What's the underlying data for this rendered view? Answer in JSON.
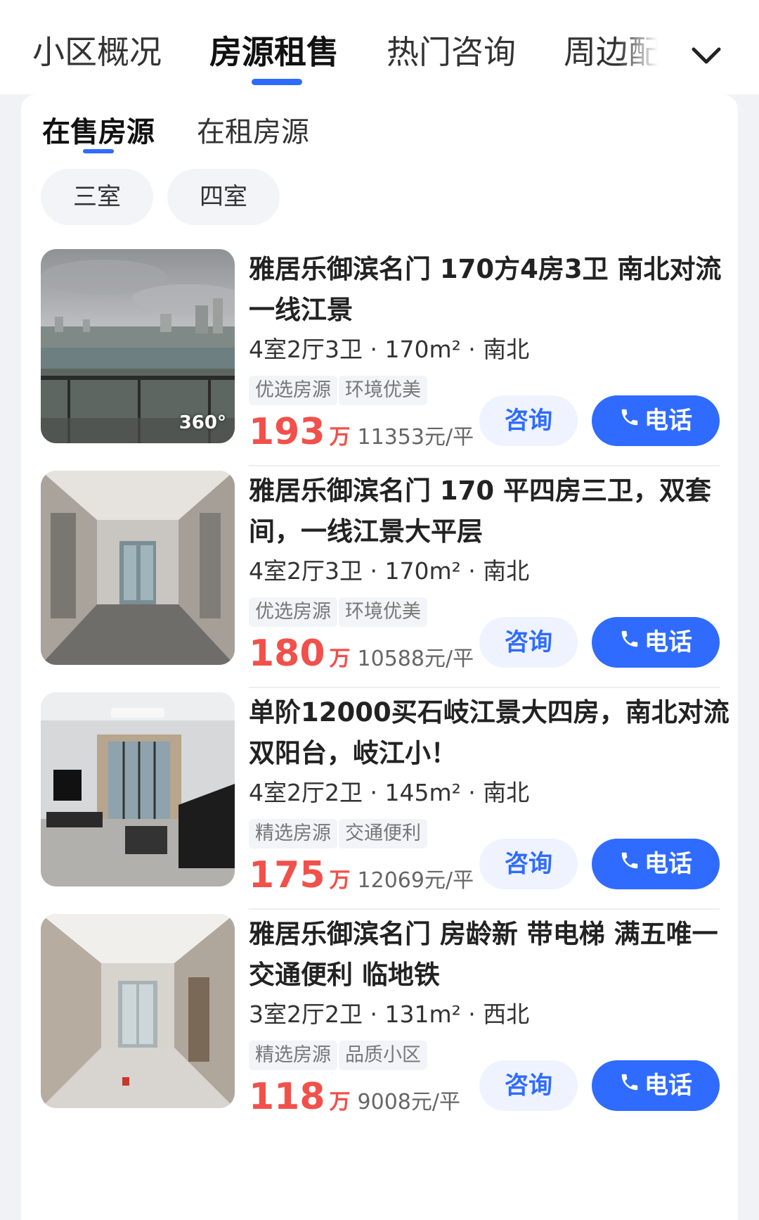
{
  "top_tabs": [
    {
      "label": "小区概况",
      "active": false
    },
    {
      "label": "房源租售",
      "active": true
    },
    {
      "label": "热门咨询",
      "active": false
    },
    {
      "label": "周边配",
      "active": false
    }
  ],
  "sub_tabs": [
    {
      "label": "在售房源",
      "active": true
    },
    {
      "label": "在租房源",
      "active": false
    }
  ],
  "filter_chips": [
    "三室",
    "四室"
  ],
  "consult_label": "咨询",
  "call_label": "电话",
  "listings": [
    {
      "title": "雅居乐御滨名门 170方4房3卫 南北对流 一线江景",
      "specs": "4室2厅3卫 · 170m² · 南北",
      "tags": [
        "优选房源",
        "环境优美"
      ],
      "price": "193",
      "price_unit": "万",
      "unit_price": "11353元/平",
      "badge": "360°"
    },
    {
      "title": "雅居乐御滨名门 170 平四房三卫，双套间，一线江景大平层",
      "specs": "4室2厅3卫 · 170m² · 南北",
      "tags": [
        "优选房源",
        "环境优美"
      ],
      "price": "180",
      "price_unit": "万",
      "unit_price": "10588元/平"
    },
    {
      "title": "单阶12000买石岐江景大四房，南北对流双阳台，岐江小！",
      "specs": "4室2厅2卫 · 145m² · 南北",
      "tags": [
        "精选房源",
        "交通便利"
      ],
      "price": "175",
      "price_unit": "万",
      "unit_price": "12069元/平"
    },
    {
      "title": "雅居乐御滨名门 房龄新 带电梯 满五唯一 交通便利 临地铁",
      "specs": "3室2厅2卫 · 131m² · 西北",
      "tags": [
        "精选房源",
        "品质小区"
      ],
      "price": "118",
      "price_unit": "万",
      "unit_price": "9008元/平"
    }
  ],
  "colors": {
    "accent": "#2f6bff",
    "price": "#f2504b",
    "tag_bg": "#f3f4f7",
    "page_bg": "#f1f2f5"
  }
}
